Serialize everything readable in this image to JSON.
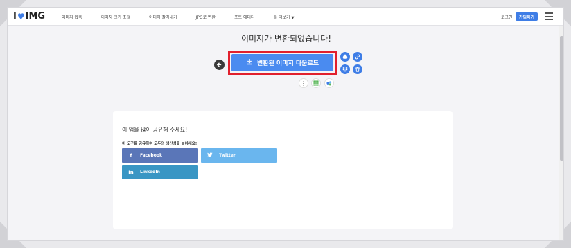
{
  "header": {
    "logo_left": "I",
    "logo_right": "IMG",
    "nav": [
      "이미지 압축",
      "이미지 크기 조절",
      "이미지 잘라내기",
      "JPG로 변환",
      "포토 에디터",
      "툴 더보기"
    ],
    "login": "로그인",
    "signup": "가입하기"
  },
  "main": {
    "title": "이미지가 변환되었습니다!",
    "download_label": "변환된 이미지 다운로드"
  },
  "share_card": {
    "heading": "이 앱을 많이 공유해 주세요!",
    "subheading": "이 도구를 공유하여 모두의 생산성을 높이세요!",
    "facebook": "Facebook",
    "twitter": "Twitter",
    "linkedin": "LinkedIn"
  },
  "colors": {
    "brand": "#3e7de6",
    "download": "#4a8bf0",
    "highlight": "#e1202d",
    "facebook": "#5a76b8",
    "twitter": "#6ab6ee",
    "linkedin": "#3996c4"
  },
  "icons": [
    "heart-icon",
    "back-arrow-icon",
    "download-icon",
    "google-drive-icon",
    "link-icon",
    "dropbox-icon",
    "trash-icon",
    "more-vertical-icon",
    "spreadsheet-icon",
    "share-app-icon",
    "facebook-icon",
    "twitter-icon",
    "linkedin-icon",
    "hamburger-menu-icon",
    "chevron-down-icon"
  ]
}
